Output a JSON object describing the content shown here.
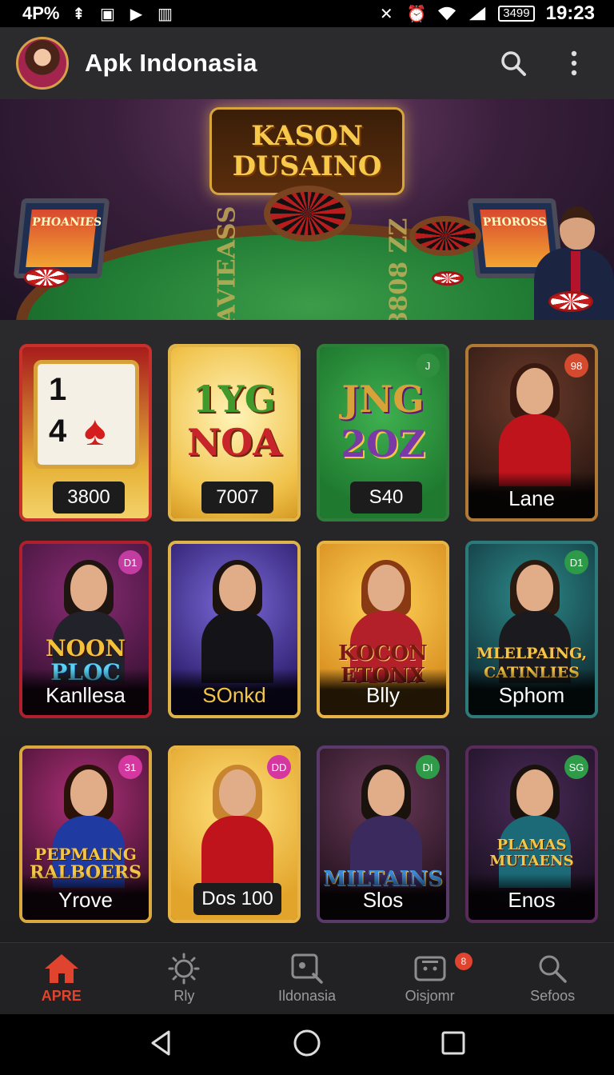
{
  "status_bar": {
    "network": "4P%",
    "battery": "3499",
    "time": "19:23"
  },
  "app_bar": {
    "title": "Apk Indonasia",
    "search_icon": "search-icon",
    "menu_icon": "more-vert-icon"
  },
  "banner": {
    "logo_line1": "KASON",
    "logo_line2": "DUSAINO",
    "machine_left": "PHOANIES",
    "machine_right": "PHOROSS",
    "table_text_left": "6AVIEASS",
    "table_text_right": "8808 ZZ"
  },
  "cards": [
    {
      "caption": "3800",
      "art_text": "",
      "badge": ""
    },
    {
      "caption": "7007",
      "art_text": "1YG NOA",
      "badge": ""
    },
    {
      "caption": "S40",
      "art_text": "JNG 2OZ",
      "badge": "J"
    },
    {
      "caption": "Lane",
      "art_text": "",
      "badge": "98"
    },
    {
      "caption": "Kanllesa",
      "art_text": "NOON PLOC",
      "badge": "D1"
    },
    {
      "caption": "SOnkd",
      "art_text": "",
      "badge": ""
    },
    {
      "caption": "Blly",
      "art_text": "KOCON ETONX",
      "badge": ""
    },
    {
      "caption": "Sphom",
      "art_text": "MLELPAING, CATINLIES",
      "badge": "D1"
    },
    {
      "caption": "Yrove",
      "art_text": "PEPMAING RALBOERS",
      "badge": "31"
    },
    {
      "caption": "Dos 100",
      "art_text": "",
      "badge": "DD"
    },
    {
      "caption": "Slos",
      "art_text": "MILTAINS",
      "badge": "DI"
    },
    {
      "caption": "Enos",
      "art_text": "PLAMAS MUTAENS",
      "badge": "SG"
    }
  ],
  "card_texts": {
    "c0_top": "1",
    "c0_bottom": "4",
    "c1_l1": "1YG",
    "c1_l2": "NOA",
    "c2_l1": "JNG",
    "c2_l2": "2OZ",
    "c4_l1": "NOON",
    "c4_l2": "PLOC",
    "c6_l1": "KOCON",
    "c6_l2": "ETONX",
    "c7_l1": "MLELPAING,",
    "c7_l2": "CATINLIES",
    "c8_l1": "PEPMAING",
    "c8_l2": "RALBOERS",
    "c10_l1": "MILTAINS",
    "c11_l1": "PLAMAS",
    "c11_l2": "MUTAENS"
  },
  "bottom_nav": [
    {
      "label": "APRE",
      "icon": "home-icon",
      "active": true
    },
    {
      "label": "Rly",
      "icon": "sun-icon",
      "active": false
    },
    {
      "label": "Ildonasia",
      "icon": "search-screen-icon",
      "active": false
    },
    {
      "label": "Oisjomr",
      "icon": "games-icon",
      "active": false,
      "badge": "8"
    },
    {
      "label": "Sefoos",
      "icon": "search-icon",
      "active": false
    }
  ],
  "colors": {
    "accent": "#e0442f",
    "gold": "#d4a04a",
    "app_bar": "#2b2b2d"
  }
}
